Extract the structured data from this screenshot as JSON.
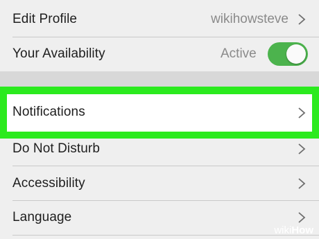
{
  "settings": {
    "edit_profile": {
      "label": "Edit Profile",
      "value": "wikihowsteve"
    },
    "availability": {
      "label": "Your Availability",
      "value": "Active",
      "toggle_on": true
    },
    "notifications": {
      "label": "Notifications"
    },
    "do_not_disturb": {
      "label": "Do Not Disturb"
    },
    "accessibility": {
      "label": "Accessibility"
    },
    "language": {
      "label": "Language"
    }
  },
  "colors": {
    "toggle": "#4cb34d",
    "highlight": "#2bea1e"
  },
  "icons": {
    "row_arrow": "chevron-right-icon"
  },
  "watermark": {
    "wiki": "wiki",
    "how": "How"
  }
}
